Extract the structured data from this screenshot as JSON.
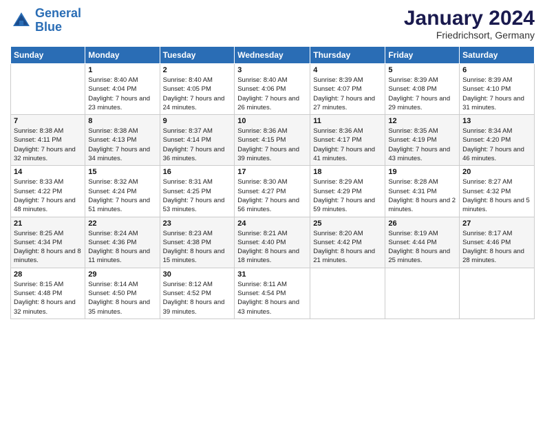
{
  "logo": {
    "line1": "General",
    "line2": "Blue"
  },
  "title": "January 2024",
  "subtitle": "Friedrichsort, Germany",
  "weekdays": [
    "Sunday",
    "Monday",
    "Tuesday",
    "Wednesday",
    "Thursday",
    "Friday",
    "Saturday"
  ],
  "weeks": [
    [
      {
        "day": "",
        "sunrise": "",
        "sunset": "",
        "daylight": ""
      },
      {
        "day": "1",
        "sunrise": "Sunrise: 8:40 AM",
        "sunset": "Sunset: 4:04 PM",
        "daylight": "Daylight: 7 hours and 23 minutes."
      },
      {
        "day": "2",
        "sunrise": "Sunrise: 8:40 AM",
        "sunset": "Sunset: 4:05 PM",
        "daylight": "Daylight: 7 hours and 24 minutes."
      },
      {
        "day": "3",
        "sunrise": "Sunrise: 8:40 AM",
        "sunset": "Sunset: 4:06 PM",
        "daylight": "Daylight: 7 hours and 26 minutes."
      },
      {
        "day": "4",
        "sunrise": "Sunrise: 8:39 AM",
        "sunset": "Sunset: 4:07 PM",
        "daylight": "Daylight: 7 hours and 27 minutes."
      },
      {
        "day": "5",
        "sunrise": "Sunrise: 8:39 AM",
        "sunset": "Sunset: 4:08 PM",
        "daylight": "Daylight: 7 hours and 29 minutes."
      },
      {
        "day": "6",
        "sunrise": "Sunrise: 8:39 AM",
        "sunset": "Sunset: 4:10 PM",
        "daylight": "Daylight: 7 hours and 31 minutes."
      }
    ],
    [
      {
        "day": "7",
        "sunrise": "Sunrise: 8:38 AM",
        "sunset": "Sunset: 4:11 PM",
        "daylight": "Daylight: 7 hours and 32 minutes."
      },
      {
        "day": "8",
        "sunrise": "Sunrise: 8:38 AM",
        "sunset": "Sunset: 4:13 PM",
        "daylight": "Daylight: 7 hours and 34 minutes."
      },
      {
        "day": "9",
        "sunrise": "Sunrise: 8:37 AM",
        "sunset": "Sunset: 4:14 PM",
        "daylight": "Daylight: 7 hours and 36 minutes."
      },
      {
        "day": "10",
        "sunrise": "Sunrise: 8:36 AM",
        "sunset": "Sunset: 4:15 PM",
        "daylight": "Daylight: 7 hours and 39 minutes."
      },
      {
        "day": "11",
        "sunrise": "Sunrise: 8:36 AM",
        "sunset": "Sunset: 4:17 PM",
        "daylight": "Daylight: 7 hours and 41 minutes."
      },
      {
        "day": "12",
        "sunrise": "Sunrise: 8:35 AM",
        "sunset": "Sunset: 4:19 PM",
        "daylight": "Daylight: 7 hours and 43 minutes."
      },
      {
        "day": "13",
        "sunrise": "Sunrise: 8:34 AM",
        "sunset": "Sunset: 4:20 PM",
        "daylight": "Daylight: 7 hours and 46 minutes."
      }
    ],
    [
      {
        "day": "14",
        "sunrise": "Sunrise: 8:33 AM",
        "sunset": "Sunset: 4:22 PM",
        "daylight": "Daylight: 7 hours and 48 minutes."
      },
      {
        "day": "15",
        "sunrise": "Sunrise: 8:32 AM",
        "sunset": "Sunset: 4:24 PM",
        "daylight": "Daylight: 7 hours and 51 minutes."
      },
      {
        "day": "16",
        "sunrise": "Sunrise: 8:31 AM",
        "sunset": "Sunset: 4:25 PM",
        "daylight": "Daylight: 7 hours and 53 minutes."
      },
      {
        "day": "17",
        "sunrise": "Sunrise: 8:30 AM",
        "sunset": "Sunset: 4:27 PM",
        "daylight": "Daylight: 7 hours and 56 minutes."
      },
      {
        "day": "18",
        "sunrise": "Sunrise: 8:29 AM",
        "sunset": "Sunset: 4:29 PM",
        "daylight": "Daylight: 7 hours and 59 minutes."
      },
      {
        "day": "19",
        "sunrise": "Sunrise: 8:28 AM",
        "sunset": "Sunset: 4:31 PM",
        "daylight": "Daylight: 8 hours and 2 minutes."
      },
      {
        "day": "20",
        "sunrise": "Sunrise: 8:27 AM",
        "sunset": "Sunset: 4:32 PM",
        "daylight": "Daylight: 8 hours and 5 minutes."
      }
    ],
    [
      {
        "day": "21",
        "sunrise": "Sunrise: 8:25 AM",
        "sunset": "Sunset: 4:34 PM",
        "daylight": "Daylight: 8 hours and 8 minutes."
      },
      {
        "day": "22",
        "sunrise": "Sunrise: 8:24 AM",
        "sunset": "Sunset: 4:36 PM",
        "daylight": "Daylight: 8 hours and 11 minutes."
      },
      {
        "day": "23",
        "sunrise": "Sunrise: 8:23 AM",
        "sunset": "Sunset: 4:38 PM",
        "daylight": "Daylight: 8 hours and 15 minutes."
      },
      {
        "day": "24",
        "sunrise": "Sunrise: 8:21 AM",
        "sunset": "Sunset: 4:40 PM",
        "daylight": "Daylight: 8 hours and 18 minutes."
      },
      {
        "day": "25",
        "sunrise": "Sunrise: 8:20 AM",
        "sunset": "Sunset: 4:42 PM",
        "daylight": "Daylight: 8 hours and 21 minutes."
      },
      {
        "day": "26",
        "sunrise": "Sunrise: 8:19 AM",
        "sunset": "Sunset: 4:44 PM",
        "daylight": "Daylight: 8 hours and 25 minutes."
      },
      {
        "day": "27",
        "sunrise": "Sunrise: 8:17 AM",
        "sunset": "Sunset: 4:46 PM",
        "daylight": "Daylight: 8 hours and 28 minutes."
      }
    ],
    [
      {
        "day": "28",
        "sunrise": "Sunrise: 8:15 AM",
        "sunset": "Sunset: 4:48 PM",
        "daylight": "Daylight: 8 hours and 32 minutes."
      },
      {
        "day": "29",
        "sunrise": "Sunrise: 8:14 AM",
        "sunset": "Sunset: 4:50 PM",
        "daylight": "Daylight: 8 hours and 35 minutes."
      },
      {
        "day": "30",
        "sunrise": "Sunrise: 8:12 AM",
        "sunset": "Sunset: 4:52 PM",
        "daylight": "Daylight: 8 hours and 39 minutes."
      },
      {
        "day": "31",
        "sunrise": "Sunrise: 8:11 AM",
        "sunset": "Sunset: 4:54 PM",
        "daylight": "Daylight: 8 hours and 43 minutes."
      },
      {
        "day": "",
        "sunrise": "",
        "sunset": "",
        "daylight": ""
      },
      {
        "day": "",
        "sunrise": "",
        "sunset": "",
        "daylight": ""
      },
      {
        "day": "",
        "sunrise": "",
        "sunset": "",
        "daylight": ""
      }
    ]
  ]
}
